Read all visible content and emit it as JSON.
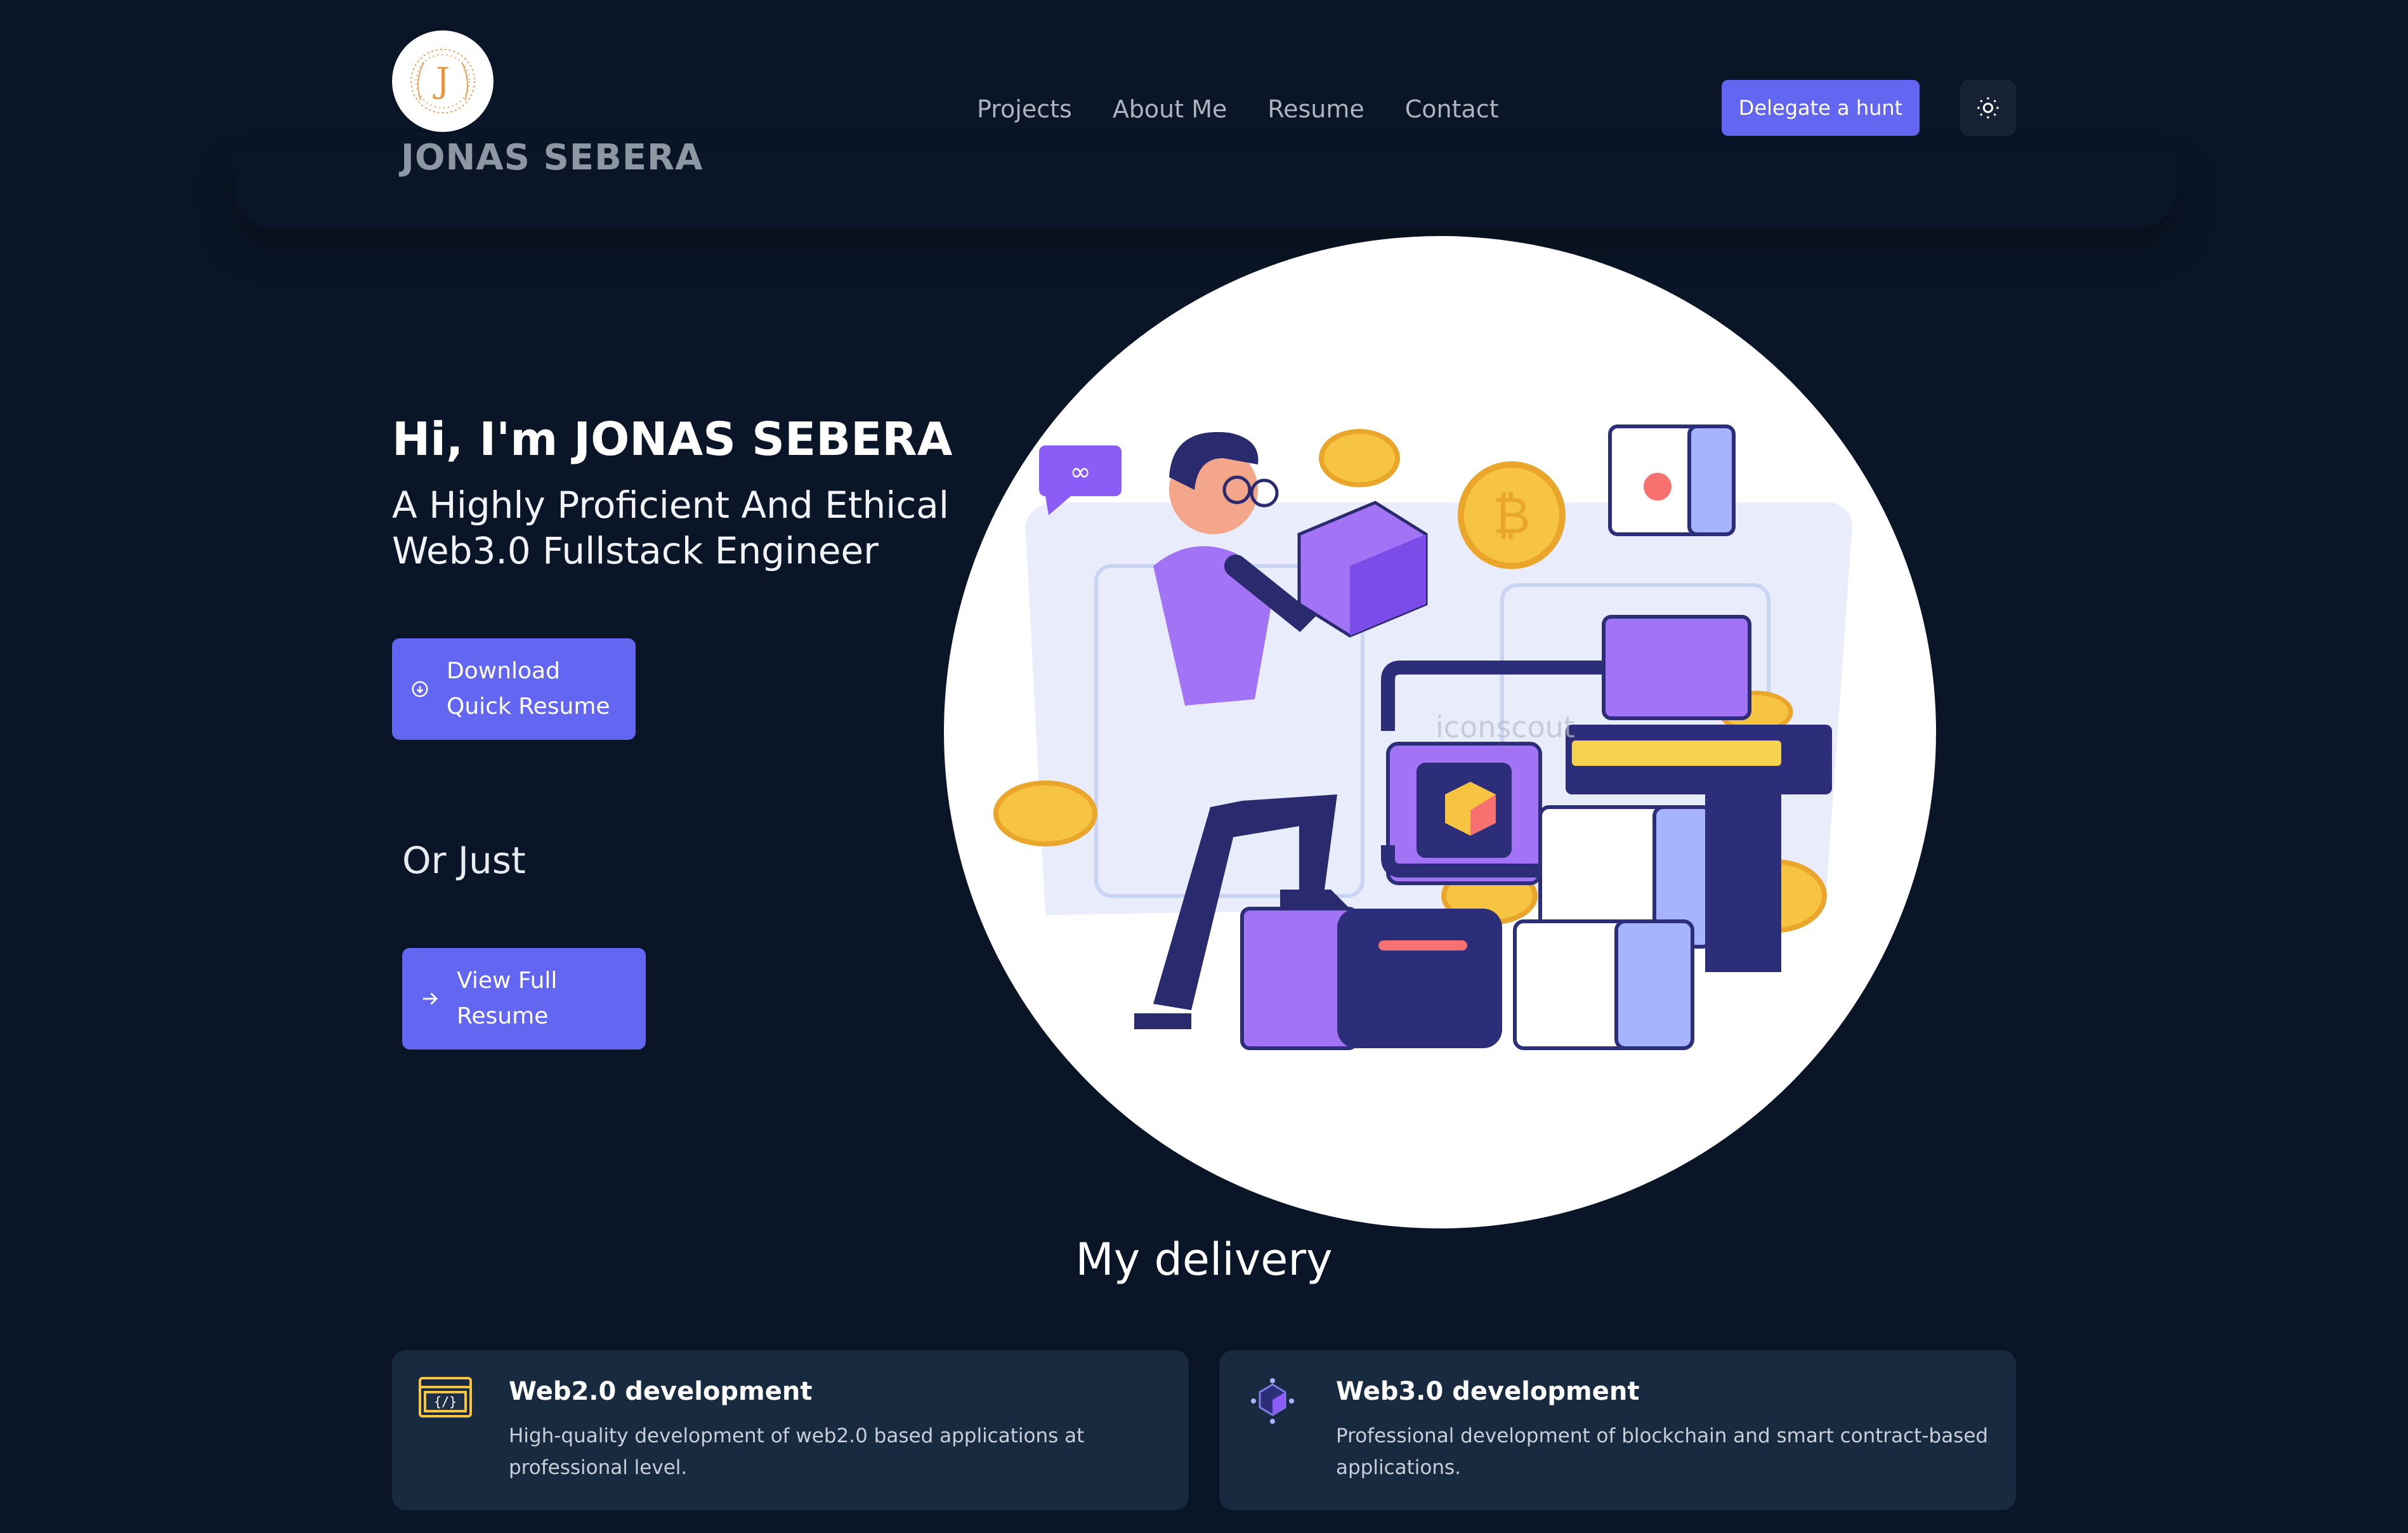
{
  "header": {
    "logo_letter": "J",
    "brand_name": "JONAS SEBERA",
    "nav": [
      "Projects",
      "About Me",
      "Resume",
      "Contact"
    ],
    "cta_label": "Delegate a hunt",
    "theme_icon": "sun-icon"
  },
  "hero": {
    "greeting": "Hi, I'm JONAS SEBERA",
    "tagline": "A Highly Proficient And Ethical Web3.0 Fullstack Engineer",
    "download_label": "Download Quick Resume",
    "or_just": "Or Just",
    "view_label": "View Full Resume",
    "illustration_watermark": "iconscout"
  },
  "delivery": {
    "title": "My delivery",
    "cards": [
      {
        "title": "Web2.0 development",
        "description": "High-quality development of web2.0 based applications at professional level.",
        "icon": "code-window-icon"
      },
      {
        "title": "Web3.0 development",
        "description": "Professional development of blockchain and smart contract-based applications.",
        "icon": "blockchain-cube-icon"
      }
    ]
  },
  "colors": {
    "background": "#0a1627",
    "accent": "#6366f1",
    "card": "#172a40",
    "brand_text": "#8d96a3"
  }
}
